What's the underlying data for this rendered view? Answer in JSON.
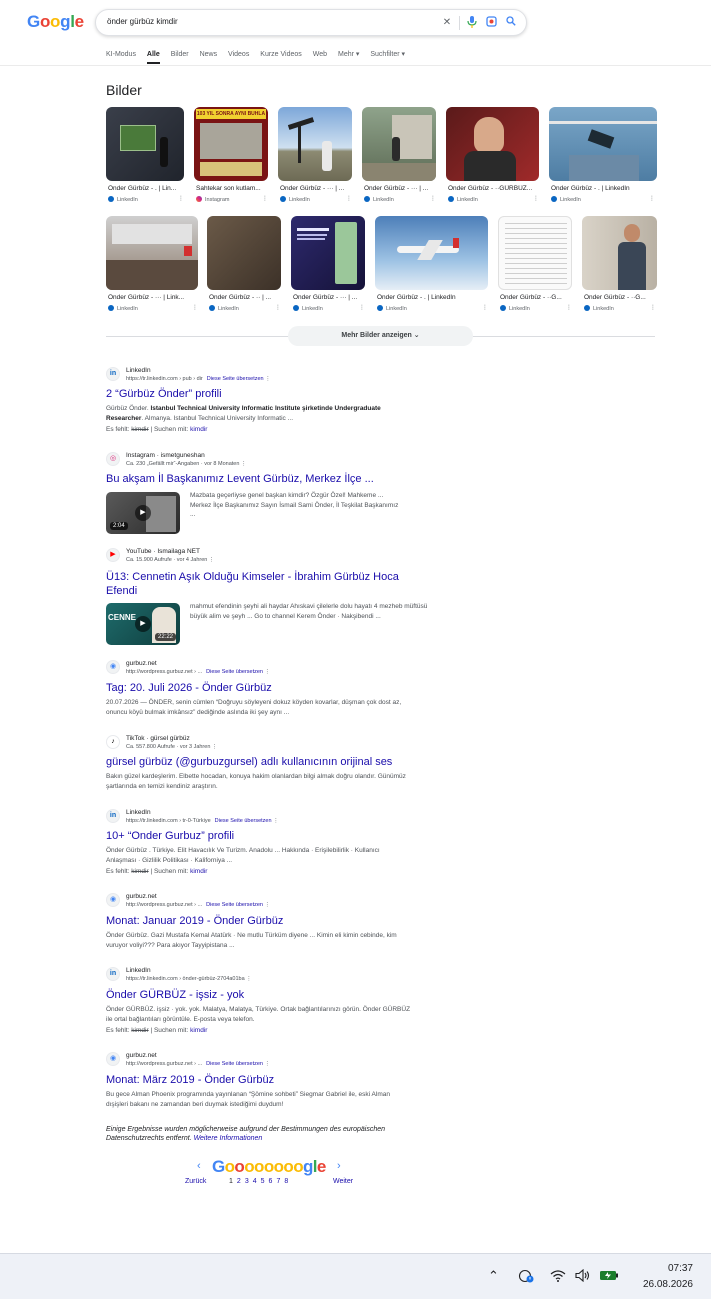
{
  "search": {
    "query": "önder gürbüz kimdir",
    "tabs": [
      "KI-Modus",
      "Alle",
      "Bilder",
      "News",
      "Videos",
      "Kurze Videos",
      "Web",
      "Mehr ▾",
      "Suchfilter ▾"
    ],
    "active_tab": "Alle"
  },
  "images": {
    "title": "Bilder",
    "row1": [
      {
        "caption": "Önder Gürbüz - . | Lin...",
        "source": "LinkedIn"
      },
      {
        "caption": "Sahtekar son kutlam...",
        "source": "Instagram"
      },
      {
        "caption": "Önder Gürbüz - ··· | ...",
        "source": "LinkedIn"
      },
      {
        "caption": "Önder Gürbüz - ··· | ...",
        "source": "LinkedIn"
      },
      {
        "caption": "Önder Gürbüz - ··GÜRBÜZ...",
        "source": "LinkedIn"
      },
      {
        "caption": "Önder Gürbüz - . | LinkedIn",
        "source": "LinkedIn"
      }
    ],
    "row2": [
      {
        "caption": "Önder Gürbüz - ··· | Link...",
        "source": "LinkedIn"
      },
      {
        "caption": "Önder Gürbüz - ·· | ...",
        "source": "LinkedIn"
      },
      {
        "caption": "Önder Gürbüz - ··· | ...",
        "source": "LinkedIn"
      },
      {
        "caption": "Önder Gürbüz - . | LinkedIn",
        "source": "LinkedIn"
      },
      {
        "caption": "Önder Gürbüz - ··G...",
        "source": "LinkedIn"
      },
      {
        "caption": "Önder Gürbüz - ··G...",
        "source": "LinkedIn"
      }
    ],
    "img1_overlay": "103 YIL SONRA AYNI BUHLA",
    "more_button": "Mehr Bilder anzeigen"
  },
  "results": [
    {
      "site": "LinkedIn",
      "url": "https://tr.linkedin.com › pub › dir",
      "translate": "Diese Seite übersetzen",
      "title": "2 “Gürbüz Önder” profili",
      "snippet_pre": "Gürbüz Önder. ",
      "snippet_bold": "Istanbul Technical University Informatic Institute şirketinde Undergraduate Researcher",
      "snippet_post": ". Almanya. Istanbul Technical University Informatic ...",
      "missing_label": "Es fehlt:",
      "missing_word": "kimdir",
      "search_with": "Suchen mit:",
      "search_with_word": "kimdir"
    },
    {
      "site": "Instagram · ismetguneshan",
      "url": "Ca. 230 „Gefällt mir“-Angaben · vor 8 Monaten",
      "title": "Bu akşam İl Başkanımız Levent Gürbüz, Merkez İlçe ...",
      "snippet": "Mazbata geçerliyse genel başkan kimdir? Özgür Özel! Mahkeme ... Merkez İlçe Başkanımız Sayın İsmail Sami Önder, İl Teşkilat Başkanımız ...",
      "duration": "2:04"
    },
    {
      "site": "YouTube · Ismailaga NET",
      "url": "Ca. 15.900 Aufrufe · vor 4 Jahren",
      "title": "Ü13: Cennetin Aşık Olduğu Kimseler - İbrahim Gürbüz Hoca",
      "title2": "Efendi",
      "snippet": "mahmut efendinin şeyhi ali haydar Ahıskavi çilelerle dolu hayatı 4 mezheb müftüsü büyük alim ve şeyh ... Go to channel Kerem Önder · Nakşibendi ...",
      "duration": "22:22"
    },
    {
      "site": "gurbuz.net",
      "url": "http://wordpress.gurbuz.net › ...",
      "translate": "Diese Seite übersetzen",
      "title": "Tag: 20. Juli 2026 - Önder Gürbüz",
      "snippet": "20.07.2026 — ÖNDER, senin cümlen “Doğruyu söyleyeni dokuz köyden kovarlar, düşman çok dost az, onuncu köyü bulmak imkânsız” dediğinde aslında iki şey aynı ..."
    },
    {
      "site": "TikTok · gürsel gürbüz",
      "url": "Ca. 557.800 Aufrufe · vor 3 Jahren",
      "title": "gürsel gürbüz (@gurbuzgursel) adlı kullanıcının orijinal ses",
      "snippet": "Bakın güzel kardeşlerim. Elbette hocadan, konuya hakim olanlardan bilgi almak doğru olandır. Günümüz şartlarında en temizi kendiniz araştırın."
    },
    {
      "site": "LinkedIn",
      "url": "https://tr.linkedin.com › tr-0-Türkiye",
      "translate": "Diese Seite übersetzen",
      "title": "10+ “Onder Gurbuz” profili",
      "snippet": "Önder Gürbüz . Türkiye. Elit Havacılık Ve Turizm. Anadolu ... Hakkında · Erişilebilirlik · Kullanıcı Anlaşması · Gizlilik Politikası · Kaliforniya ...",
      "missing_label": "Es fehlt:",
      "missing_word": "kimdir",
      "search_with": "Suchen mit:",
      "search_with_word": "kimdir"
    },
    {
      "site": "gurbuz.net",
      "url": "http://wordpress.gurbuz.net › ...",
      "translate": "Diese Seite übersetzen",
      "title": "Monat: Januar 2019 - Önder Gürbüz",
      "snippet": "Önder Gürbüz. Gazi Mustafa Kemal Atatürk · Ne mutlu Türküm diyene ... Kimin eli kimin cebinde, kim vuruyor voliyi??? Para akıyor Tayyipistana ..."
    },
    {
      "site": "LinkedIn",
      "url": "https://tr.linkedin.com › önder-gürbüz-2704a01ba",
      "title": "Önder GÜRBÜZ - işsiz - yok",
      "snippet": "Önder GÜRBÜZ. işsiz · yok. yok. Malatya, Malatya, Türkiye. Ortak bağlantılarınızı görün. Önder GÜRBÜZ ile ortal bağlantıları görüntüle. E-posta veya telefon.",
      "missing_label": "Es fehlt:",
      "missing_word": "kimdir",
      "search_with": "Suchen mit:",
      "search_with_word": "kimdir"
    },
    {
      "site": "gurbuz.net",
      "url": "http://wordpress.gurbuz.net › ...",
      "translate": "Diese Seite übersetzen",
      "title": "Monat: März 2019 - Önder Gürbüz",
      "snippet": "Bu gece Alman Phoenix programında yayınlanan “Şömine sohbeti” Siegmar Gabriel ile, eski Alman dışişleri bakanı ne zamandan beri duymak istediğimi duydum!"
    }
  ],
  "legal": {
    "text": "Einige Ergebnisse wurden möglicherweise aufgrund der Bestimmungen des europäischen Datenschutzrechts entfernt.",
    "link": "Weitere Informationen"
  },
  "pagination": {
    "logo": "Goooooooogle",
    "prev": "Zurück",
    "next": "Weiter",
    "pages": [
      "1",
      "2",
      "3",
      "4",
      "5",
      "6",
      "7",
      "8"
    ],
    "current": "1"
  },
  "taskbar": {
    "time": "07:37",
    "date": "26.08.2026"
  },
  "colors": {
    "link": "#1a0dab",
    "google_blue": "#4285f4",
    "google_red": "#ea4335",
    "google_yellow": "#fbbc05",
    "google_green": "#34a853"
  }
}
